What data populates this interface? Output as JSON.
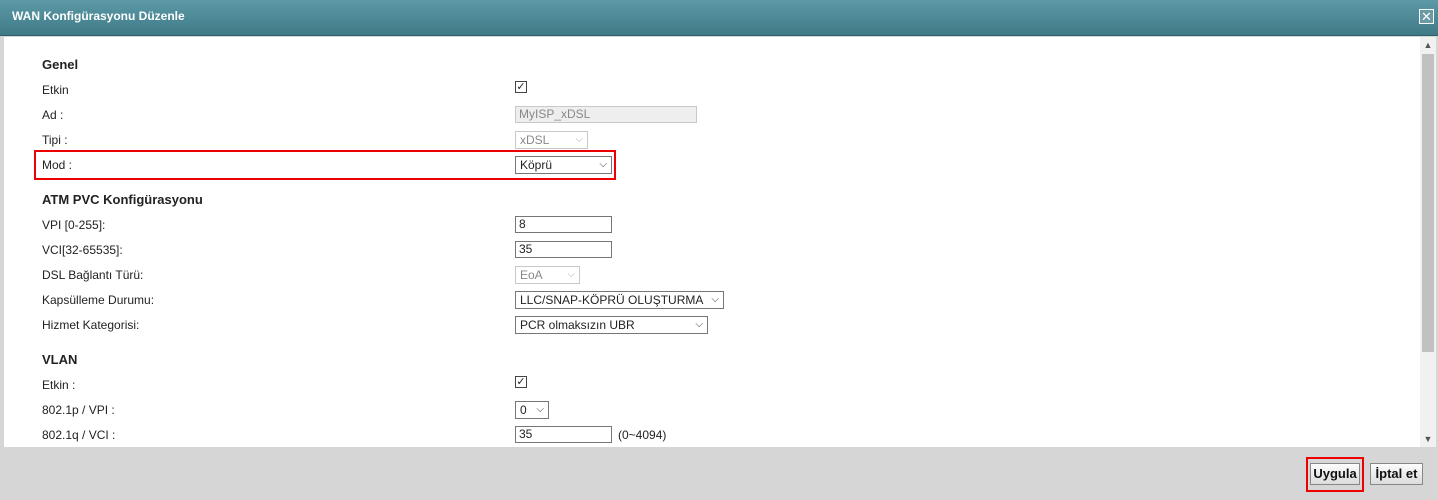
{
  "dialog": {
    "title": "WAN Konfigürasyonu Düzenle",
    "close_glyph": "✕"
  },
  "general": {
    "heading": "Genel",
    "enabled_label": "Etkin",
    "name_label": "Ad :",
    "name_value": "MyISP_xDSL",
    "type_label": "Tipi :",
    "type_value": "xDSL",
    "mode_label": "Mod :",
    "mode_value": "Köprü"
  },
  "atm": {
    "heading": "ATM PVC Konfigürasyonu",
    "vpi_label": "VPI [0-255]:",
    "vpi_value": "8",
    "vci_label": "VCI[32-65535]:",
    "vci_value": "35",
    "dsl_type_label": "DSL Bağlantı Türü:",
    "dsl_type_value": "EoA",
    "encap_label": "Kapsülleme Durumu:",
    "encap_value": "LLC/SNAP-KÖPRÜ OLUŞTURMA",
    "service_label": "Hizmet Kategorisi:",
    "service_value": "PCR olmaksızın UBR"
  },
  "vlan": {
    "heading": "VLAN",
    "enabled_label": "Etkin :",
    "p_label": "802.1p / VPI :",
    "p_value": "0",
    "q_label": "802.1q / VCI :",
    "q_value": "35",
    "q_hint": "(0~4094)"
  },
  "glyphs": {
    "check": "✓",
    "chevron": "⌵",
    "up": "▲",
    "down": "▼"
  },
  "footer": {
    "apply_label": "Uygula",
    "cancel_label": "İptal et"
  },
  "colors": {
    "titlebar": "#4a8a96",
    "highlight": "#e00000"
  }
}
